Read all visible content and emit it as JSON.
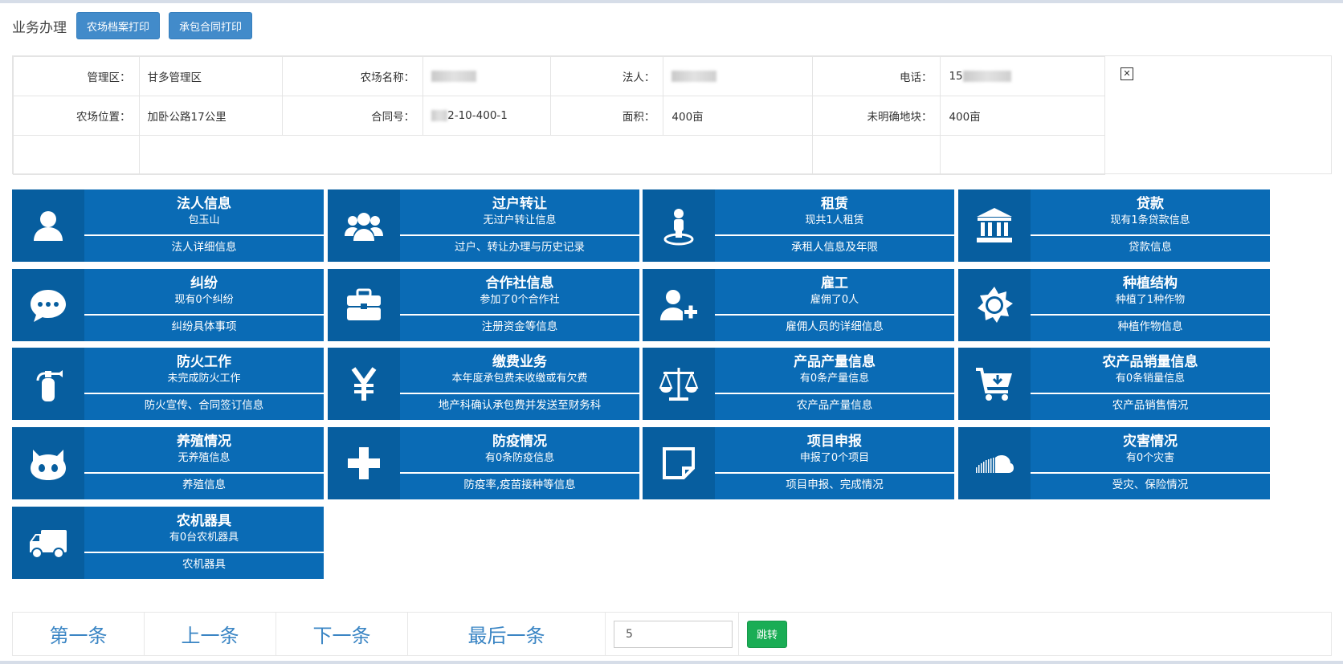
{
  "header": {
    "title": "业务办理",
    "print_archive_label": "农场档案打印",
    "print_contract_label": "承包合同打印"
  },
  "info": {
    "row1": [
      {
        "label": "管理区：",
        "value": "甘多管理区"
      },
      {
        "label": "农场名称：",
        "value": ""
      },
      {
        "label": "法人：",
        "value": ""
      },
      {
        "label": "电话：",
        "value": "15"
      }
    ],
    "row2": [
      {
        "label": "农场位置：",
        "value": "加卧公路17公里"
      },
      {
        "label": "合同号：",
        "value": "2-10-400-1"
      },
      {
        "label": "面积：",
        "value": "400亩"
      },
      {
        "label": "未明确地块：",
        "value": "400亩"
      }
    ],
    "photo_icon": "broken-image-icon"
  },
  "tiles": [
    {
      "title": "法人信息",
      "sub": "包玉山",
      "link": "法人详细信息",
      "icon": "user-icon"
    },
    {
      "title": "过户转让",
      "sub": "无过户转让信息",
      "link": "过户、转让办理与历史记录",
      "icon": "group-icon"
    },
    {
      "title": "租赁",
      "sub": "现共1人租赁",
      "link": "承租人信息及年限",
      "icon": "street-view-icon"
    },
    {
      "title": "贷款",
      "sub": "现有1条贷款信息",
      "link": "贷款信息",
      "icon": "bank-icon"
    },
    {
      "title": "纠纷",
      "sub": "现有0个纠纷",
      "link": "纠纷具体事项",
      "icon": "comment-icon"
    },
    {
      "title": "合作社信息",
      "sub": "参加了0个合作社",
      "link": "注册资金等信息",
      "icon": "briefcase-icon"
    },
    {
      "title": "雇工",
      "sub": "雇佣了0人",
      "link": "雇佣人员的详细信息",
      "icon": "user-plus-icon"
    },
    {
      "title": "种植结构",
      "sub": "种植了1种作物",
      "link": "种植作物信息",
      "icon": "sun-icon"
    },
    {
      "title": "防火工作",
      "sub": "未完成防火工作",
      "link": "防火宣传、合同签订信息",
      "icon": "fire-extinguisher-icon"
    },
    {
      "title": "缴费业务",
      "sub": "本年度承包费未收缴或有欠费",
      "link": "地产科确认承包费并发送至财务科",
      "icon": "yen-icon"
    },
    {
      "title": "产品产量信息",
      "sub": "有0条产量信息",
      "link": "农产品产量信息",
      "icon": "balance-scale-icon"
    },
    {
      "title": "农产品销量信息",
      "sub": "有0条销量信息",
      "link": "农产品销售情况",
      "icon": "cart-download-icon"
    },
    {
      "title": "养殖情况",
      "sub": "无养殖信息",
      "link": "养殖信息",
      "icon": "github-cat-icon"
    },
    {
      "title": "防疫情况",
      "sub": "有0条防疫信息",
      "link": "防疫率,疫苗接种等信息",
      "icon": "plus-icon"
    },
    {
      "title": "项目申报",
      "sub": "申报了0个项目",
      "link": "项目申报、完成情况",
      "icon": "sticky-note-icon"
    },
    {
      "title": "灾害情况",
      "sub": "有0个灾害",
      "link": "受灾、保险情况",
      "icon": "soundcloud-icon"
    },
    {
      "title": "农机器具",
      "sub": "有0台农机器具",
      "link": "农机器具",
      "icon": "truck-icon"
    }
  ],
  "pager": {
    "first": "第一条",
    "prev": "上一条",
    "next": "下一条",
    "last": "最后一条",
    "jump_value": "5",
    "jump_button": "跳转"
  },
  "colors": {
    "tile_bg": "#0a6bb5",
    "tile_icon_bg": "#075e9f",
    "header_button": "#428bca",
    "jump_button": "#1aad55",
    "pager_text": "#3a85c4"
  }
}
